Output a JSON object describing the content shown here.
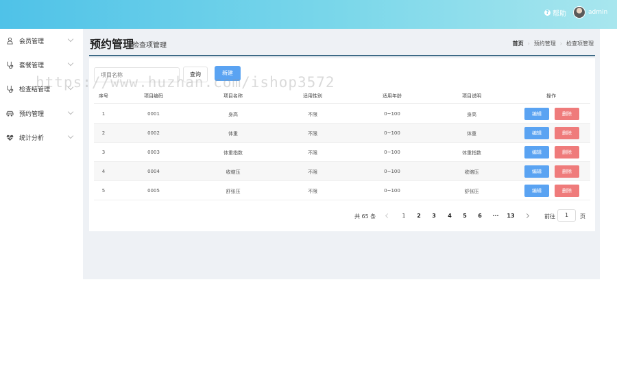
{
  "topbar": {
    "help_label": "帮助",
    "help_icon": "question-circle-icon",
    "username": "admin"
  },
  "sidebar": {
    "items": [
      {
        "label": "会员管理",
        "icon": "user-icon"
      },
      {
        "label": "套餐管理",
        "icon": "stethoscope-icon"
      },
      {
        "label": "检查结管理",
        "icon": "stethoscope-icon"
      },
      {
        "label": "预约管理",
        "icon": "car-icon"
      },
      {
        "label": "统计分析",
        "icon": "heart-pulse-icon"
      }
    ]
  },
  "page": {
    "title": "预约管理",
    "subtitle": "检查项管理",
    "breadcrumbs": [
      "首页",
      "预约管理",
      "检查项管理"
    ]
  },
  "toolbar": {
    "search_placeholder": "项目名称",
    "query_label": "查询",
    "new_label": "新建"
  },
  "table": {
    "headers": [
      "序号",
      "项目编码",
      "项目名称",
      "适用性别",
      "适用年龄",
      "项目说明",
      "操作"
    ],
    "rows": [
      [
        "1",
        "0001",
        "身高",
        "不限",
        "0~100",
        "身高"
      ],
      [
        "2",
        "0002",
        "体重",
        "不限",
        "0~100",
        "体重"
      ],
      [
        "3",
        "0003",
        "体重指数",
        "不限",
        "0~100",
        "体重指数"
      ],
      [
        "4",
        "0004",
        "收缩压",
        "不限",
        "0~100",
        "收缩压"
      ],
      [
        "5",
        "0005",
        "舒张压",
        "不限",
        "0~100",
        "舒张压"
      ]
    ],
    "edit_label": "编辑",
    "delete_label": "删除"
  },
  "pagination": {
    "total": "共 65 条",
    "pages": [
      "1",
      "2",
      "3",
      "4",
      "5",
      "6",
      "···",
      "13"
    ],
    "goto_label": "前往",
    "goto_value": "1",
    "page_unit": "页"
  },
  "watermark": "https://www.huzhan.com/ishop3572",
  "colors": {
    "primary": "#5aa3f2",
    "danger": "#ef7b7b",
    "header_gradient_start": "#4fc2e8"
  }
}
